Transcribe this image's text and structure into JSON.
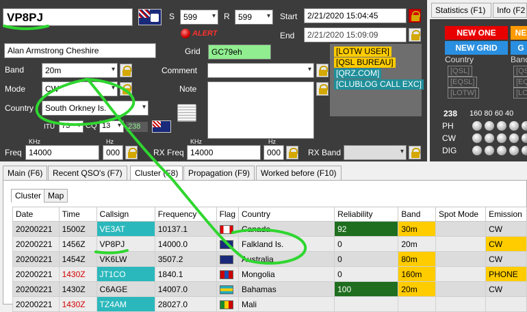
{
  "qso": {
    "callsign": "VP8PJ",
    "s_label": "S",
    "s_value": "599",
    "r_label": "R",
    "r_value": "599",
    "start_label": "Start",
    "start_value": "2/21/2020 15:04:45",
    "end_label": "End",
    "end_value": "2/21/2020 15:09:09",
    "alert_label": "ALERT",
    "name": "Alan Armstrong Cheshire",
    "grid_label": "Grid",
    "grid_value": "GC79eh",
    "band_label": "Band",
    "band_value": "20m",
    "comment_label": "Comment",
    "comment_value": "",
    "mode_label": "Mode",
    "mode_value": "CW",
    "note_label": "Note",
    "country_label": "Country",
    "country_value": "South Orkney Is.",
    "itu_label": "ITU",
    "itu_value": "73",
    "cq_label": "CQ",
    "cq_value": "13",
    "dxcc_value": "238",
    "freq_label": "Freq",
    "freq_khz_label": "KHz",
    "freq_value": "14000",
    "freq_hz_label": "Hz",
    "freq_hz_value": "000",
    "rxfreq_label": "RX Freq",
    "rxfreq_khz_label": "KHz",
    "rxfreq_value": "14000",
    "rxfreq_hz_label": "Hz",
    "rxfreq_hz_value": "000",
    "rxband_label": "RX Band",
    "rxband_value": ""
  },
  "tags": [
    "[LOTW USER]",
    "[QSL BUREAU]",
    "[QRZ.COM]",
    "[CLUBLOG CALL EXC]"
  ],
  "stats": {
    "tab1": "Statistics (F1)",
    "tab2": "Info (F2",
    "new_one": "NEW ONE",
    "new_grid": "NEW GRID",
    "country_label": "Country",
    "band_label": "Band",
    "qsl": "[QSL]",
    "eqsl": "[EQSL]",
    "lotw": "[LOTW]",
    "qsl2": "[QSL",
    "eqsl2": "[EQ",
    "lotw2": "[LO",
    "count": "238",
    "bands": "160 80 60 40",
    "ph": "PH",
    "cw": "CW",
    "dig": "DIG"
  },
  "tabs": [
    "Main (F6)",
    "Recent QSO's (F7)",
    "Cluster (F8)",
    "Propagation (F9)",
    "Worked before (F10)"
  ],
  "subtabs": [
    "Cluster",
    "Map"
  ],
  "table": {
    "headers": [
      "Date",
      "Time",
      "Callsign",
      "Frequency",
      "Flag",
      "Country",
      "Reliability",
      "Band",
      "Spot Mode",
      "Emission"
    ],
    "rows": [
      [
        "20200221",
        "1500Z",
        "VE3AT",
        "10137.1",
        "",
        "Canada",
        "92",
        "30m",
        "",
        "CW"
      ],
      [
        "20200221",
        "1456Z",
        "VP8PJ",
        "14000.0",
        "",
        "Falkland Is.",
        "0",
        "20m",
        "",
        "CW"
      ],
      [
        "20200221",
        "1454Z",
        "VK6LW",
        "3507.2",
        "",
        "Australia",
        "0",
        "80m",
        "",
        "CW"
      ],
      [
        "20200221",
        "1430Z",
        "JT1CO",
        "1840.1",
        "",
        "Mongolia",
        "0",
        "160m",
        "",
        "PHONE"
      ],
      [
        "20200221",
        "1430Z",
        "C6AGE",
        "14007.0",
        "",
        "Bahamas",
        "100",
        "20m",
        "",
        "CW"
      ],
      [
        "20200221",
        "1430Z",
        "TZ4AM",
        "28027.0",
        "",
        "Mali",
        "",
        "",
        "",
        ""
      ]
    ]
  },
  "colors": {
    "panel": "#3c3c3c",
    "highlight_yellow": "#ffcc00",
    "teal": "#2bb8bc",
    "green_dark": "#1f6e1f",
    "red_time": "#d40000",
    "grid_green": "#90ee90"
  }
}
